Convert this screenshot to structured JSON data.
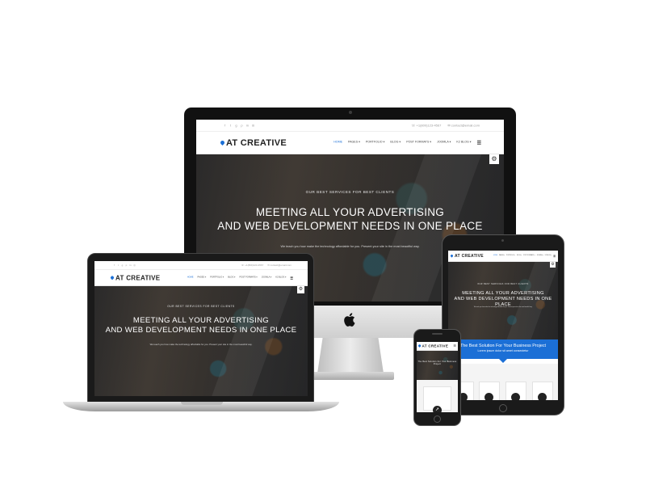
{
  "brand": {
    "logo_text": "AT CREATIVE",
    "accent_color": "#1b6fd6"
  },
  "topbar": {
    "social_icons": [
      "facebook-icon",
      "twitter-icon",
      "google-plus-icon",
      "pinterest-icon",
      "linkedin-icon",
      "instagram-icon"
    ],
    "social_glyphs": [
      "f",
      "t",
      "g",
      "p",
      "in",
      "◎"
    ],
    "phone": "☏ +1(800)123-4567",
    "email": "✉ contact@email.com"
  },
  "nav": {
    "items": [
      {
        "label": "HOME"
      },
      {
        "label": "PAGES ▾"
      },
      {
        "label": "PORTFOLIO ▾"
      },
      {
        "label": "BLOG ▾"
      },
      {
        "label": "POST FORMATS ▾"
      },
      {
        "label": "JOOMLA ▾"
      },
      {
        "label": "K2 BLOG ▾"
      }
    ],
    "menu_icon": "☰"
  },
  "hero": {
    "subtitle": "OUR BEST SERVICES FOR BEST CLIENTS",
    "title_line1": "MEETING ALL YOUR ADVERTISING",
    "title_line2": "AND WEB DEVELOPMENT NEEDS IN ONE PLACE",
    "description": "We teach you how make the technology affordable for you. Present your site in the most beautiful way."
  },
  "settings_icon": "⚙",
  "tablet_section": {
    "title": "The Best Solution For Your Business Project",
    "subtitle": "Lorem ipsum dolor sit amet consectetur"
  },
  "phone_section": {
    "text": "The Best Solution For Your Business Project"
  }
}
